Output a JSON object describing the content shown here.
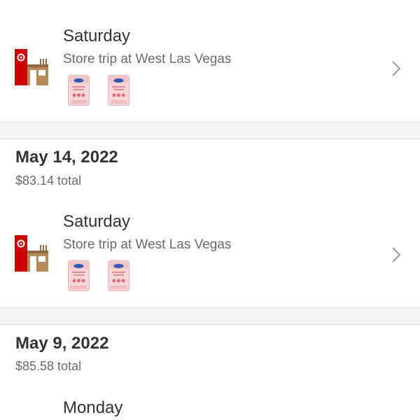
{
  "groups": [
    {
      "trips": [
        {
          "day": "Saturday",
          "description": "Store trip at West Las Vegas",
          "icon": "target-store-icon",
          "products": [
            "enfamil-formula-tub",
            "enfamil-formula-tub"
          ]
        }
      ]
    },
    {
      "date": "May 14, 2022",
      "total": "$83.14 total",
      "trips": [
        {
          "day": "Saturday",
          "description": "Store trip at West Las Vegas",
          "icon": "target-store-icon",
          "products": [
            "enfamil-formula-tub",
            "enfamil-formula-tub"
          ]
        }
      ]
    },
    {
      "date": "May 9, 2022",
      "total": "$85.58 total",
      "trips": [
        {
          "day": "Monday"
        }
      ]
    }
  ],
  "colors": {
    "target_red": "#cc0000",
    "store_brown": "#b48a5a",
    "text_primary": "#333333",
    "text_secondary": "#6b6b6b",
    "separator_band": "#f4f4f4",
    "chevron": "#9a9a9a",
    "product_pink": "#f3c4c8"
  }
}
